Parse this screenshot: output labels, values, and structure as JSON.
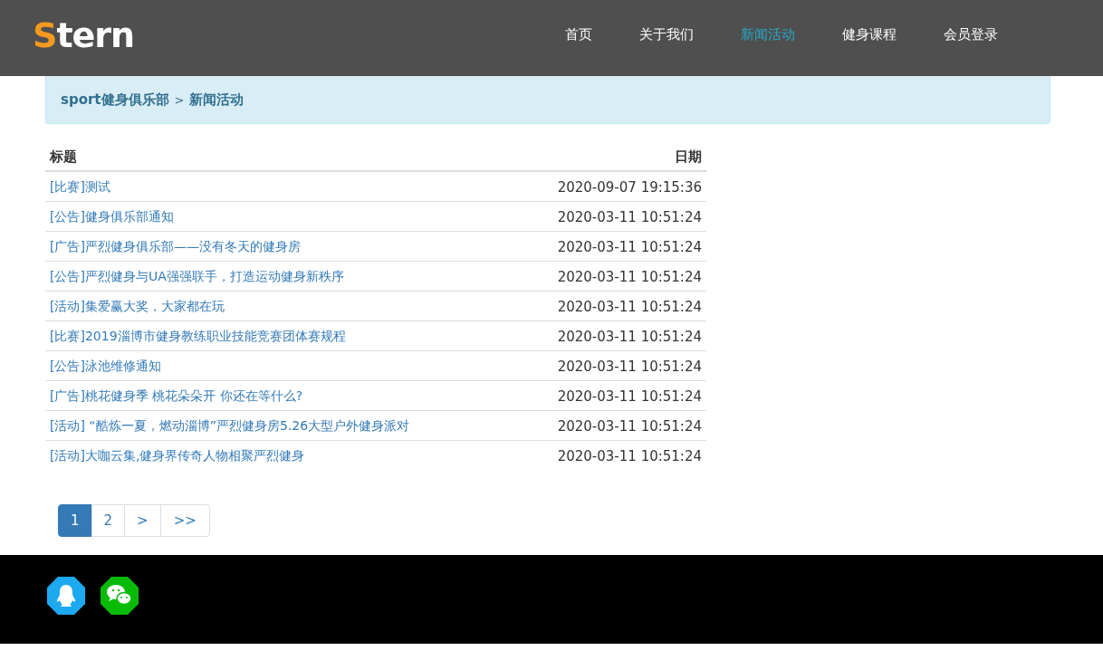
{
  "logo": {
    "initial": "S",
    "rest": "tern"
  },
  "nav": [
    {
      "label": "首页",
      "selected": false
    },
    {
      "label": "关于我们",
      "selected": false
    },
    {
      "label": "新闻活动",
      "selected": true
    },
    {
      "label": "健身课程",
      "selected": false
    },
    {
      "label": "会员登录",
      "selected": false
    }
  ],
  "breadcrumb": {
    "home": "sport健身俱乐部",
    "separator": ">",
    "current": "新闻活动"
  },
  "table": {
    "columns": [
      "标题",
      "日期"
    ],
    "rows": [
      {
        "title": "[比赛]测试",
        "date": "2020-09-07 19:15:36"
      },
      {
        "title": "[公告]健身俱乐部通知",
        "date": "2020-03-11 10:51:24"
      },
      {
        "title": "[广告]严烈健身俱乐部——没有冬天的健身房",
        "date": "2020-03-11 10:51:24"
      },
      {
        "title": "[公告]严烈健身与UA强强联手，打造运动健身新秩序",
        "date": "2020-03-11 10:51:24"
      },
      {
        "title": "[活动]集爱赢大奖，大家都在玩",
        "date": "2020-03-11 10:51:24"
      },
      {
        "title": "[比赛]2019淄博市健身教练职业技能竞赛团体赛规程",
        "date": "2020-03-11 10:51:24"
      },
      {
        "title": "[公告]泳池维修通知",
        "date": "2020-03-11 10:51:24"
      },
      {
        "title": "[广告]桃花健身季 桃花朵朵开 你还在等什么?",
        "date": "2020-03-11 10:51:24"
      },
      {
        "title": "[活动] “酷炼一夏，燃动淄博”严烈健身房5.26大型户外健身派对",
        "date": "2020-03-11 10:51:24"
      },
      {
        "title": "[活动]大咖云集,健身界传奇人物相聚严烈健身",
        "date": "2020-03-11 10:51:24"
      }
    ]
  },
  "pagination": [
    {
      "label": "1",
      "selected": true
    },
    {
      "label": "2",
      "selected": false
    },
    {
      "label": ">",
      "selected": false
    },
    {
      "label": ">>",
      "selected": false
    }
  ],
  "footer": {
    "icons": [
      {
        "kind": "qq"
      },
      {
        "kind": "wechat"
      }
    ]
  }
}
